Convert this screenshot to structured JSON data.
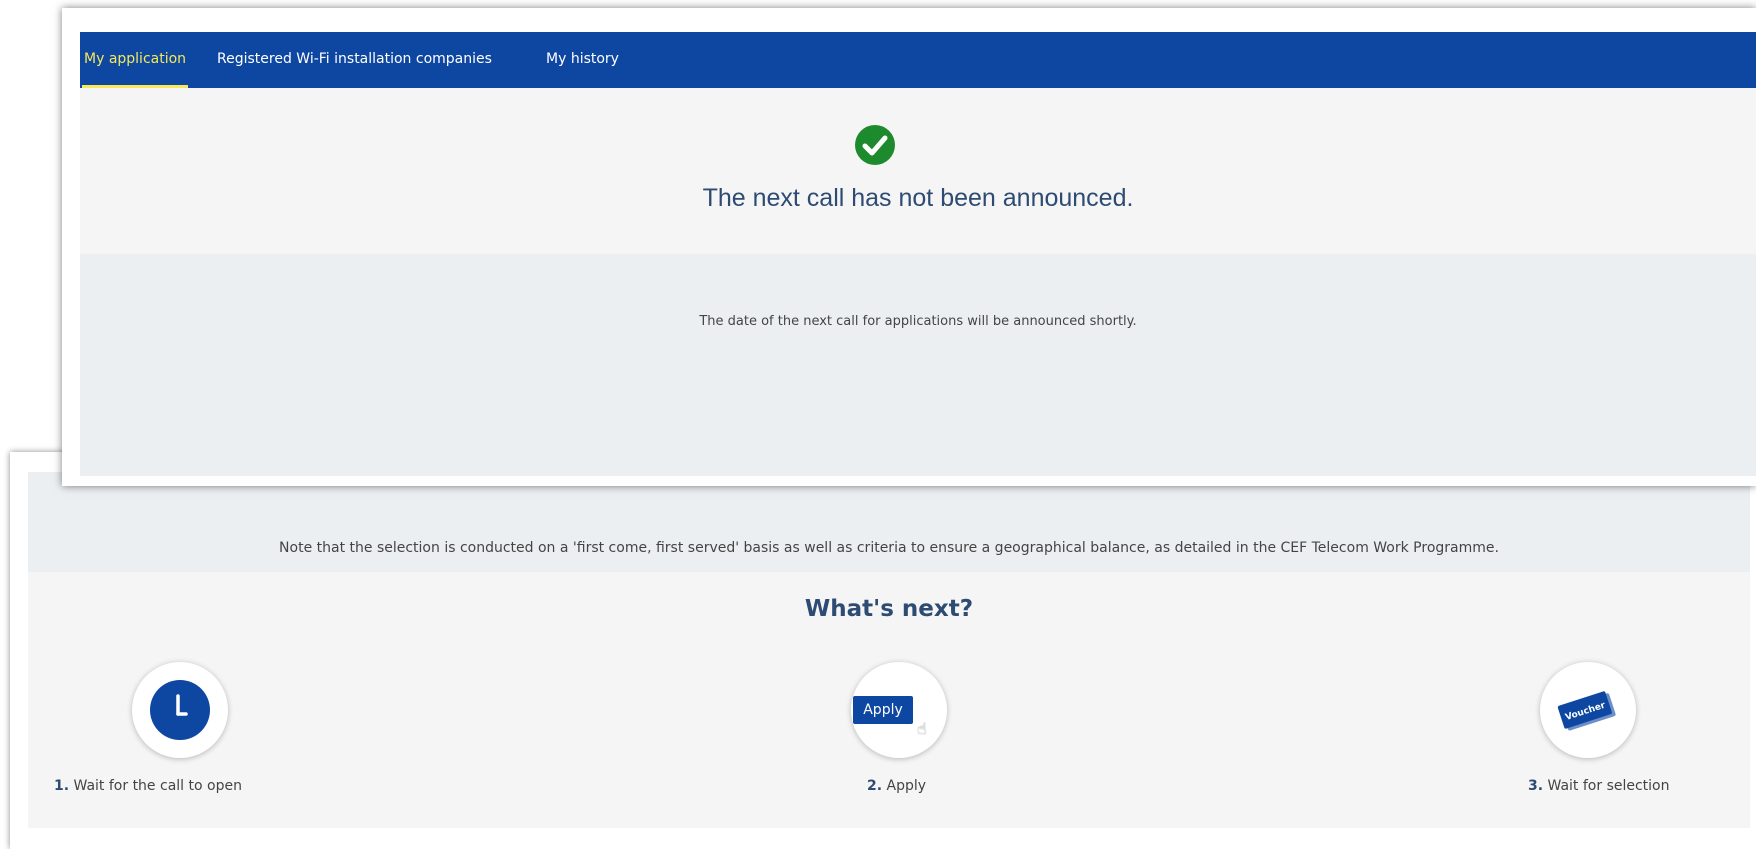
{
  "nav": {
    "tabs": [
      {
        "label": "My application",
        "active": true
      },
      {
        "label": "Registered Wi-Fi installation companies",
        "active": false
      },
      {
        "label": "My history",
        "active": false
      }
    ]
  },
  "status": {
    "icon": "check-circle-icon",
    "title": "The next call has not been announced."
  },
  "info": {
    "text": "The date of the next call for applications will be announced shortly."
  },
  "note": {
    "text": "Note that the selection is conducted on a 'first come, first served' basis as well as criteria to ensure a geographical balance, as detailed in the CEF Telecom Work Programme."
  },
  "whats_next": {
    "title": "What's next?",
    "steps": [
      {
        "number": "1.",
        "label": "Wait for the call to open",
        "icon": "clock-icon"
      },
      {
        "number": "2.",
        "label": "Apply",
        "icon": "apply-button-icon",
        "icon_text": "Apply"
      },
      {
        "number": "3.",
        "label": "Wait for selection",
        "icon": "voucher-icon",
        "icon_text": "Voucher"
      }
    ]
  },
  "colors": {
    "nav_background": "#0e47a1",
    "active_tab": "#f6e85a",
    "heading": "#2e4b73",
    "success": "#1e8a2e"
  }
}
